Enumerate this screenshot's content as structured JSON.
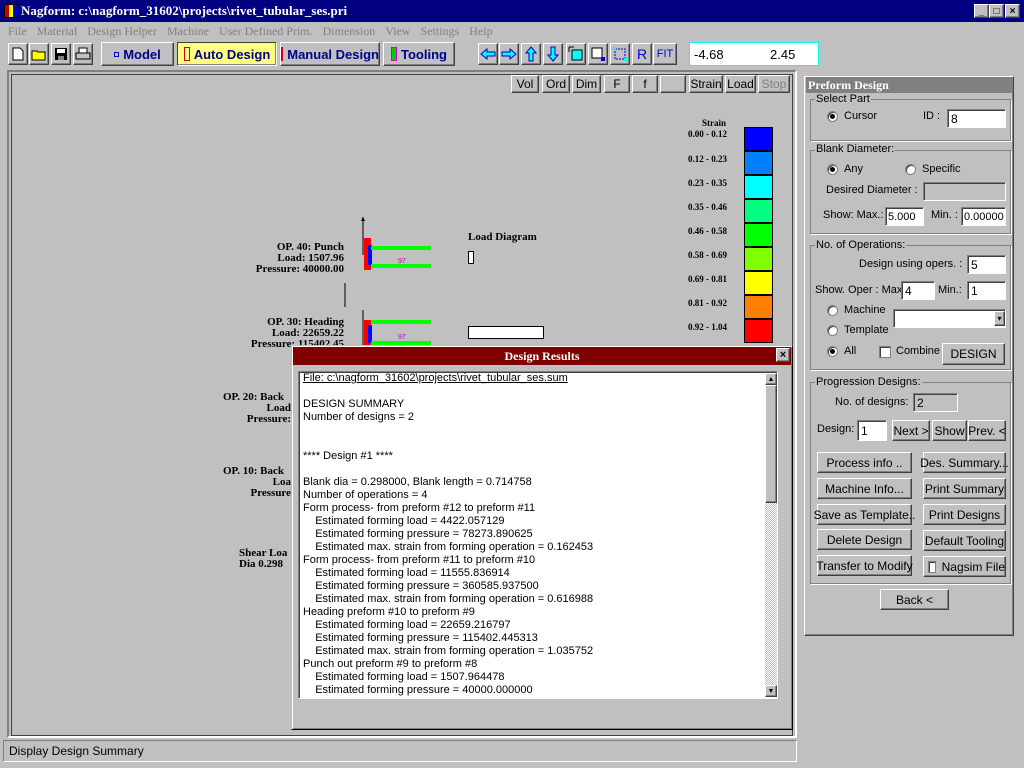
{
  "window": {
    "title": "Nagform: c:\\nagform_31602\\projects\\rivet_tubular_ses.pri",
    "minimize": "_",
    "maximize": "□",
    "close": "×"
  },
  "menu": [
    "File",
    "Material",
    "Design Helper",
    "Machine",
    "User Defined Prim.",
    "Dimension",
    "View",
    "Settings",
    "Help"
  ],
  "toolbar": {
    "file_icons": [
      "new-file",
      "open-folder",
      "save-disk",
      "print"
    ],
    "modes": [
      "Model",
      "Auto Design",
      "Manual Design",
      "Tooling"
    ],
    "nav_icons": [
      "arrow-left",
      "arrow-right",
      "arrow-up",
      "arrow-down",
      "zoom-window",
      "zoom-out",
      "zoom-in"
    ],
    "r_label": "R",
    "fit_label": "FIT",
    "coord_x": "-4.68",
    "coord_y": "2.45"
  },
  "view_buttons": [
    "Vol",
    "Ord",
    "Dim",
    "F",
    "f",
    "",
    "Strain",
    "Load",
    "Stop"
  ],
  "legend": {
    "title": "Strain",
    "ranges": [
      "0.00 - 0.12",
      "0.12 - 0.23",
      "0.23 - 0.35",
      "0.35 - 0.46",
      "0.46 - 0.58",
      "0.58 - 0.69",
      "0.69 - 0.81",
      "0.81 - 0.92",
      "0.92 - 1.04"
    ],
    "colors": [
      "#0000ff",
      "#0080ff",
      "#00ffff",
      "#00ff80",
      "#00ff00",
      "#80ff00",
      "#ffff00",
      "#ff8000",
      "#ff0000"
    ]
  },
  "load_diagram": {
    "title": "Load Diagram"
  },
  "operations": [
    {
      "name": "OP. 40: Punch",
      "load": "Load: 1507.96",
      "pressure": "Pressure: 40000.00",
      "part_label": "97"
    },
    {
      "name": "OP. 30: Heading",
      "load": "Load: 22659.22",
      "pressure": "Pressure: 115402.45",
      "part_label": "97"
    },
    {
      "name": "OP. 20: Back",
      "load": "Load",
      "pressure": "Pressure:"
    },
    {
      "name": "OP. 10: Back",
      "load": "Loa",
      "pressure": "Pressure"
    }
  ],
  "shear": {
    "line1": "Shear Loa",
    "line2": "Dia 0.298"
  },
  "dialog": {
    "title": "Design Results",
    "lines": [
      "File: c:\\nagform_31602\\projects\\rivet_tubular_ses.sum",
      "",
      "DESIGN SUMMARY",
      "Number of designs = 2",
      "",
      "",
      "**** Design #1 ****",
      "",
      "Blank dia = 0.298000, Blank length = 0.714758",
      "Number of operations = 4",
      "Form process- from preform #12 to preform #11",
      "    Estimated forming load = 4422.057129",
      "    Estimated forming pressure = 78273.890625",
      "    Estimated max. strain from forming operation = 0.162453",
      "Form process- from preform #11 to preform #10",
      "    Estimated forming load = 11555.836914",
      "    Estimated forming pressure = 360585.937500",
      "    Estimated max. strain from forming operation = 0.616988",
      "Heading preform #10 to preform #9",
      "    Estimated forming load = 22659.216797",
      "    Estimated forming pressure = 115402.445313",
      "    Estimated max. strain from forming operation = 1.035752",
      "Punch out preform #9 to preform #8",
      "    Estimated forming load = 1507.964478",
      "    Estimated forming pressure = 40000.000000"
    ]
  },
  "panel": {
    "title": "Preform Design",
    "select_part": {
      "label": "Select Part",
      "cursor": "Cursor",
      "id_label": "ID :",
      "id_value": "8"
    },
    "blank": {
      "label": "Blank Diameter:",
      "any": "Any",
      "specific": "Specific",
      "desired_label": "Desired Diameter :",
      "desired_value": "",
      "show_max_label": "Show: Max.:",
      "max_value": "5.000",
      "min_label": "Min. :",
      "min_value": "0.00000"
    },
    "ops": {
      "label": "No. of Operations:",
      "design_using_label": "Design using opers. :",
      "design_using_value": "5",
      "show_oper_label": "Show. Oper : Max",
      "max_value": "4",
      "min_label": "Min.:",
      "min_value": "1",
      "machine": "Machine",
      "template": "Template",
      "all": "All",
      "combine": "Combine",
      "design_button": "DESIGN"
    },
    "progression": {
      "label": "Progression Designs:",
      "num_label": "No. of designs:",
      "num_value": "2",
      "design_label": "Design:",
      "design_value": "1",
      "next": "Next >",
      "show": "Show",
      "prev": "Prev. <"
    },
    "buttons": [
      "Process info ..",
      "Des. Summary...",
      "Machine Info...",
      "Print Summary",
      "Save as Template..",
      "Print Designs",
      "Delete Design",
      "Default Tooling",
      "Transfer to Modify"
    ],
    "nagsim": "Nagsim File",
    "back": "Back <"
  },
  "status": "Display Design Summary"
}
